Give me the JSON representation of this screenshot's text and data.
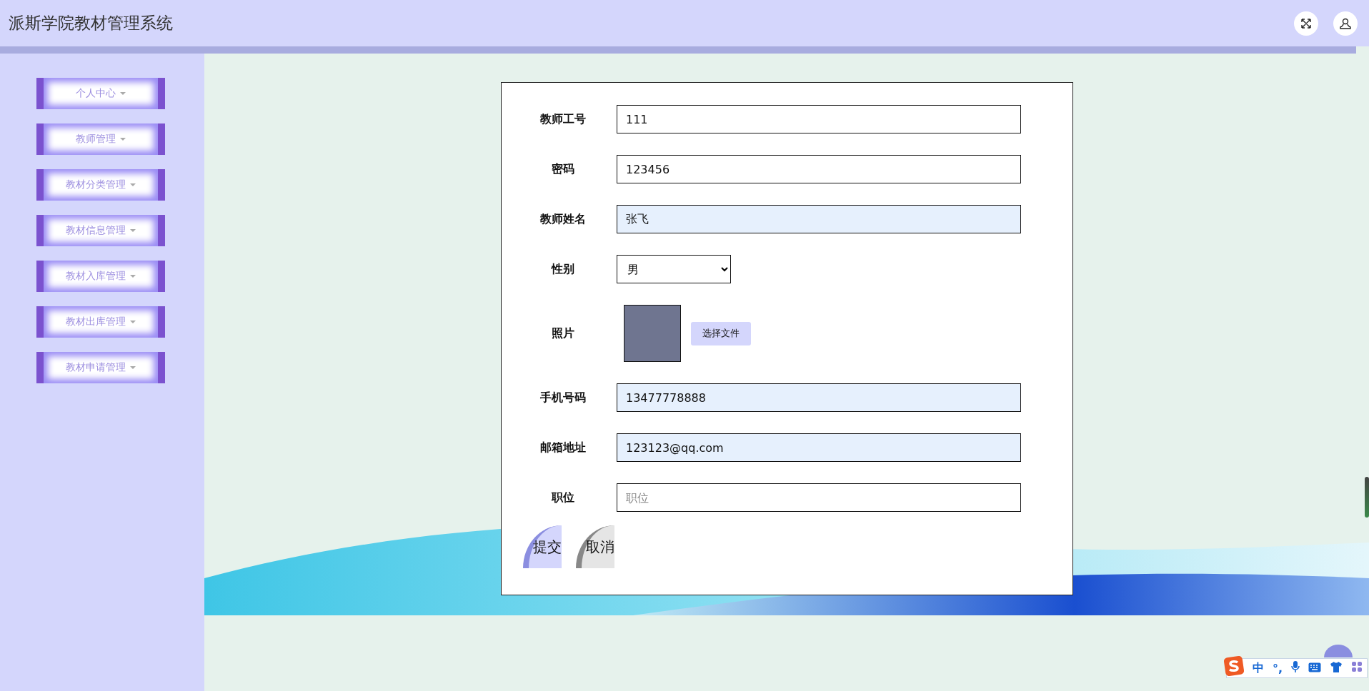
{
  "header": {
    "title": "派斯学院教材管理系统"
  },
  "sidebar": {
    "items": [
      {
        "label": "个人中心"
      },
      {
        "label": "教师管理"
      },
      {
        "label": "教材分类管理"
      },
      {
        "label": "教材信息管理"
      },
      {
        "label": "教材入库管理"
      },
      {
        "label": "教材出库管理"
      },
      {
        "label": "教材申请管理"
      }
    ]
  },
  "form": {
    "fields": [
      {
        "kind": "text",
        "label": "教师工号",
        "value": "111",
        "autofilled": false
      },
      {
        "kind": "text",
        "label": "密码",
        "value": "123456",
        "autofilled": false
      },
      {
        "kind": "text",
        "label": "教师姓名",
        "value": "张飞",
        "autofilled": true
      },
      {
        "kind": "select",
        "label": "性别",
        "value": "男"
      },
      {
        "kind": "file",
        "label": "照片",
        "button": "选择文件"
      },
      {
        "kind": "text",
        "label": "手机号码",
        "value": "13477778888",
        "autofilled": true
      },
      {
        "kind": "text",
        "label": "邮箱地址",
        "value": "123123@qq.com",
        "autofilled": true
      },
      {
        "kind": "text",
        "label": "职位",
        "placeholder": "职位",
        "autofilled": false
      }
    ],
    "buttons": [
      {
        "label": "提交",
        "kind": "primary"
      },
      {
        "label": "取消",
        "kind": "secondary"
      }
    ]
  },
  "ime_toolbar": {
    "mode": "中",
    "punctuation": "°,"
  }
}
